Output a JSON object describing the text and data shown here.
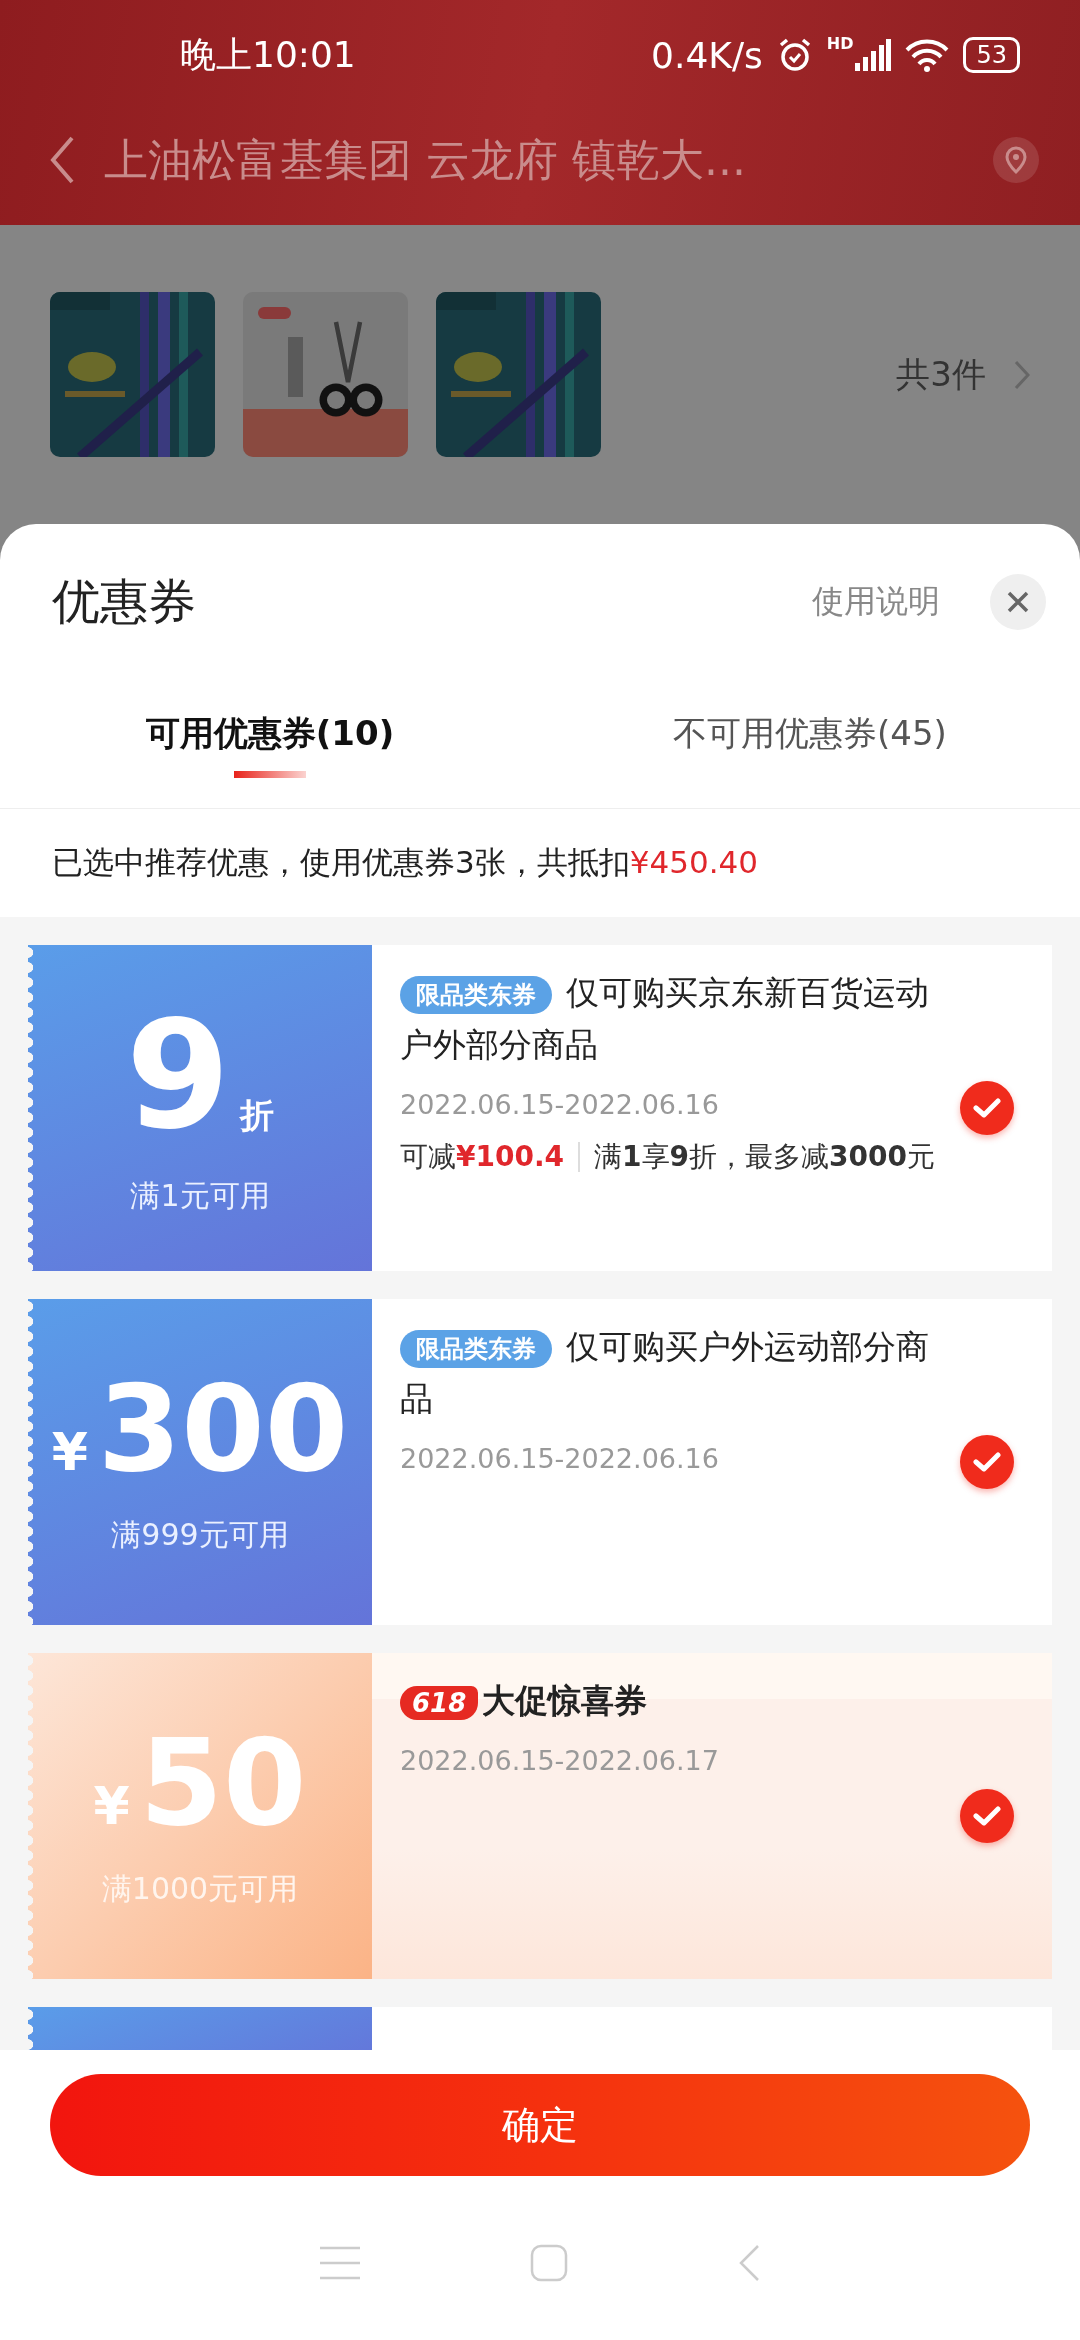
{
  "status_bar": {
    "time": "晚上10:01",
    "speed": "0.4K/s",
    "network": "HD",
    "battery": "53"
  },
  "header": {
    "address": "上油松富基集团 云龙府 镇乾大..."
  },
  "order": {
    "count": "共3件"
  },
  "sheet": {
    "title": "优惠券",
    "help": "使用说明",
    "tabs": [
      {
        "label": "可用优惠券(10)",
        "selected": true
      },
      {
        "label": "不可用优惠券(45)",
        "selected": false
      }
    ],
    "summary": {
      "text": "已选中推荐优惠，使用优惠券3张，共抵扣",
      "amount": "¥450.40"
    },
    "coupons": [
      {
        "kind": "discount",
        "value": "9",
        "unit": "折",
        "condition": "满1元可用",
        "tag": {
          "kind": "pill",
          "text": "限品类东券"
        },
        "title": "仅可购买京东新百货运动户外部分商品",
        "dates": "2022.06.15-2022.06.16",
        "saving": {
          "label": "可减",
          "amount": "¥100.4",
          "rule": "满**1**享**9**折，最多减**3000**元"
        },
        "selected": true
      },
      {
        "kind": "amount",
        "currency": "¥",
        "value": "300",
        "condition": "满999元可用",
        "tag": {
          "kind": "pill",
          "text": "限品类东券"
        },
        "title": "仅可购买户外运动部分商品",
        "dates": "2022.06.15-2022.06.16",
        "selected": true
      },
      {
        "kind": "amount",
        "currency": "¥",
        "value": "50",
        "condition": "满1000元可用",
        "tag": {
          "kind": "promo",
          "text": "618"
        },
        "title": "大促惊喜券",
        "dates": "2022.06.15-2022.06.17",
        "selected": true
      }
    ]
  },
  "confirm_button": "确定"
}
